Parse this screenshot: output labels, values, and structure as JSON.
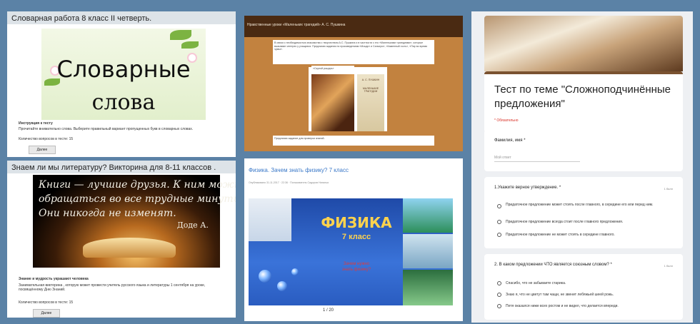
{
  "panel1": {
    "header": "Словарная работа 8 класс II четверть.",
    "image_line1": "Словарные",
    "image_line2": "слова",
    "instructions_title": "Инструкция к тесту",
    "instructions_text": "Прочитайте внимательно слова. Выберите правильный вариант пропущенных букв в словарных словах.",
    "questions_count": "Количество вопросов в тесте: 15",
    "button": "Далее"
  },
  "panel2": {
    "header": "Знаем ли мы литературу? Викторина для 8-11 классов .",
    "quote_line1": "Книги — лучшие друзья. К ним можно",
    "quote_line2": "обращаться во все трудные минуты жизни.",
    "quote_line3": "Они никогда не изменят.",
    "author": "Доде А.",
    "subtitle": "Знание и мудрость украшают человека",
    "text": "Занимательная викторина , которую может провести учитель русского языка и литературы 1 сентября на уроке, посвящённому Дню Знаний.",
    "questions_count": "Количество вопросов в тесте: 15",
    "button": "Далее"
  },
  "panel3": {
    "title": "Нравственные уроки «Маленьких трагедий» А. С. Пушкина",
    "note1": "В связи с необходимостью знакомства с творчеством А.С. Пушкина и в частности с его «Маленькими трагедиями», которые вызывают интерес у учащихся. Предлагаю задания по произведениям «Моцарт и Сальери», «Каменный гость», «Пир во время чумы».",
    "note2": "«Скупой рыцарь»",
    "note3": "Предлагаю задание для проверки знаний.",
    "book_author": "А. С. ПУШКИН",
    "book_title": "МАЛЕНЬКИЕ ТРАГЕДИИ"
  },
  "panel4": {
    "title": "Физика. Зачем знать физику? 7 класс",
    "meta": "Опубликовано 31.11.2017 · 22:36 · Пользователь Сидоров Наталья",
    "slide_title": "ФИЗИКА",
    "slide_grade": "7 класс",
    "slide_question_line1": "Зачем нужно",
    "slide_question_line2": "знать физику?",
    "pager": "1 / 20"
  },
  "panel5": {
    "form_title": "Тест по теме \"Сложноподчинённые предложения\"",
    "required_note": "* Обязательно",
    "name_label": "Фамилия, имя *",
    "name_placeholder": "Мой ответ",
    "q1": {
      "label": "1.Укажите верное утверждение. *",
      "points": "1 балл",
      "options": [
        "Придаточное предложение может стоять после главного, в середине его или перед ним.",
        "Придаточное предложение всегда стоит после главного предложения.",
        "Придаточное предложение не может стоять в середине главного."
      ]
    },
    "q2": {
      "label": "2. В каком предложении ЧТО является союзным словом? *",
      "points": "1 балл",
      "options": [
        "Спасибо, что не забываете старика.",
        "Знаю я, что не цветут там чащи, не звенит лебяжьей шеей рожь.",
        "Петя оказался ниже всех ростом и не видел, что делается впереди."
      ]
    }
  }
}
